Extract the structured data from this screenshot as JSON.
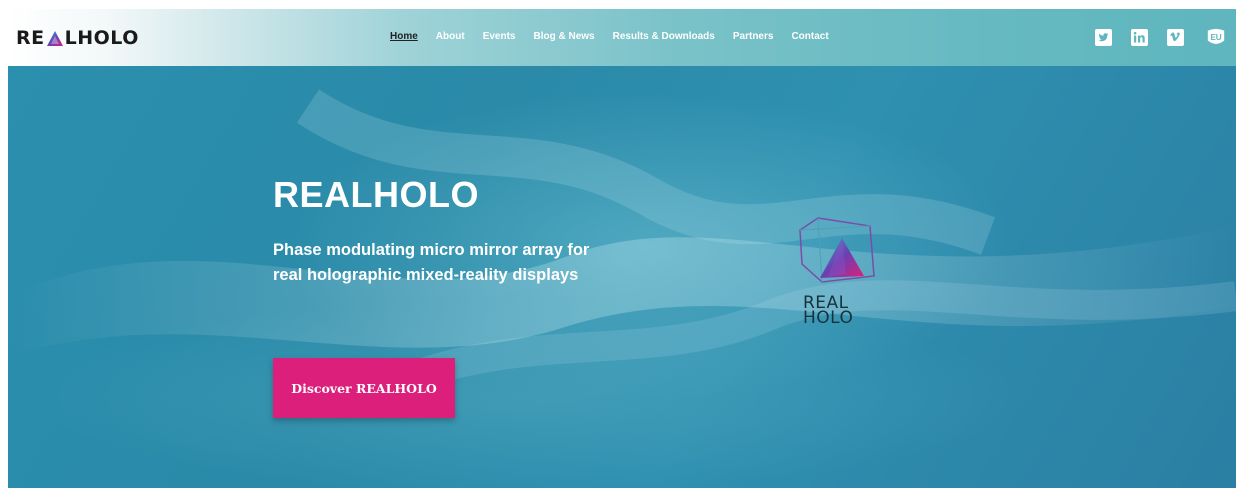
{
  "brand": {
    "logo_left": "RE",
    "logo_right": "LHOLO",
    "accent": "#dc1f7a"
  },
  "nav": {
    "items": [
      {
        "label": "Home",
        "active": true
      },
      {
        "label": "About"
      },
      {
        "label": "Events"
      },
      {
        "label": "Blog & News"
      },
      {
        "label": "Results & Downloads"
      },
      {
        "label": "Partners"
      },
      {
        "label": "Contact"
      }
    ]
  },
  "social": {
    "icons": [
      "twitter-icon",
      "linkedin-icon",
      "vimeo-icon",
      "eu-icon"
    ],
    "eu_label": "EU"
  },
  "hero": {
    "title": "REALHOLO",
    "subtitle_line1": "Phase modulating micro mirror array for",
    "subtitle_line2": "real holographic mixed-reality displays",
    "cta_label": "Discover REALHOLO",
    "mark_line1": "REAL",
    "mark_line2": "HOLO"
  }
}
